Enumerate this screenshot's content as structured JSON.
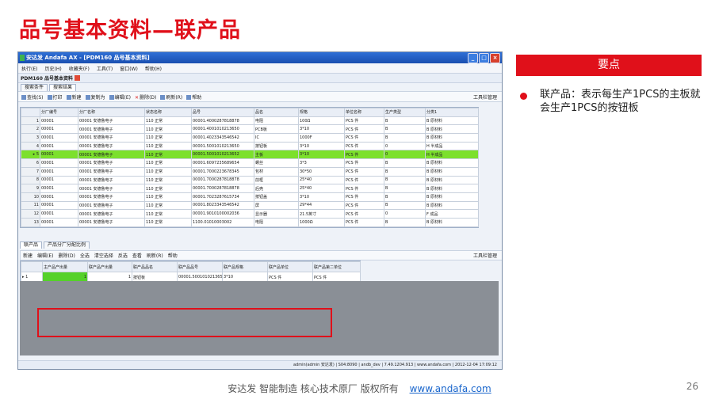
{
  "slide": {
    "title": "品号基本资料—联产品",
    "key_header": "要点",
    "bullet_text": "联产品：表示每生产1PCS的主板就会生产1PCS的按钮板",
    "footer_text": "安达发  智能制造 核心技术原厂  版权所有",
    "footer_link": "www.andafa.com",
    "page_number": "26"
  },
  "window": {
    "title": "安达发 Andafa AX - [PDM160 品号基本资料]",
    "buttons": [
      "_",
      "□",
      "×"
    ],
    "menu": [
      "执行(E)",
      "历史(H)",
      "收藏夹(F)",
      "工具(T)",
      "窗口(W)",
      "帮助(H)"
    ],
    "doc_title": "PDM160 品号基本资料",
    "tabs": [
      "搜索条件",
      "搜索结果"
    ],
    "toolbar": [
      "查找(S)",
      "打印",
      "新建",
      "复制为",
      "编辑(E)",
      "删除(D)",
      "刷新(R)",
      "帮助"
    ],
    "toolbar_right": "工具栏管理",
    "grid_headers": [
      "",
      "分厂编号",
      "分厂名称",
      "状态名称",
      "品号",
      "品名",
      "规格",
      "单位名称",
      "生产类型",
      "分类1"
    ],
    "grid_rows": [
      [
        "1",
        "00001",
        "00001 安德鲁电子",
        "110 正常",
        "00001.4000287818878",
        "电阻",
        "100Ω",
        "PCS 件",
        "B",
        "B 原材料"
      ],
      [
        "2",
        "00001",
        "00001 安德鲁电子",
        "110 正常",
        "00001.4001010213650",
        "PCB板",
        "3*10",
        "PCS 件",
        "B",
        "B 原材料"
      ],
      [
        "3",
        "00001",
        "00001 安德鲁电子",
        "110 正常",
        "00001.4023343546542",
        "IC",
        "1000F",
        "PCS 件",
        "B",
        "B 原材料"
      ],
      [
        "4",
        "00001",
        "00001 安德鲁电子",
        "110 正常",
        "00001.5001010213650",
        "按钮板",
        "3*10",
        "PCS 件",
        "0",
        "H 半成品"
      ],
      [
        "5",
        "00001",
        "00001 安德鲁电子",
        "110 正常",
        "00001.5001010213652",
        "主板",
        "3*10",
        "PCS 件",
        "0",
        "H 半成品"
      ],
      [
        "6",
        "00001",
        "00001 安德鲁电子",
        "110 正常",
        "00001.6097235689654",
        "螺丝",
        "3*3",
        "PCS 件",
        "B",
        "B 原材料"
      ],
      [
        "7",
        "00001",
        "00001 安德鲁电子",
        "110 正常",
        "00001.7000223678345",
        "包材",
        "30*50",
        "PCS 件",
        "B",
        "B 原材料"
      ],
      [
        "8",
        "00001",
        "00001 安德鲁电子",
        "110 正常",
        "00001.7000287818878",
        "前框",
        "25*40",
        "PCS 件",
        "B",
        "B 原材料"
      ],
      [
        "9",
        "00001",
        "00001 安德鲁电子",
        "110 正常",
        "00001.7000287818878",
        "后壳",
        "25*40",
        "PCS 件",
        "B",
        "B 原材料"
      ],
      [
        "10",
        "00001",
        "00001 安德鲁电子",
        "110 正常",
        "00001.7023287615734",
        "按钮盖",
        "3*10",
        "PCS 件",
        "B",
        "B 原材料"
      ],
      [
        "11",
        "00001",
        "00001 安德鲁电子",
        "110 正常",
        "00001.8023343546542",
        "屏",
        "29*44",
        "PCS 件",
        "B",
        "B 原材料"
      ],
      [
        "12",
        "00001",
        "00001 安德鲁电子",
        "110 正常",
        "00001.9010100002036",
        "显示器",
        "21.5英寸",
        "PCS 件",
        "0",
        "F 成品"
      ],
      [
        "13",
        "00001",
        "00001 安德鲁电子",
        "110 正常",
        "1100.01010003002",
        "电阻",
        "1000Ω",
        "PCS 件",
        "B",
        "B 原材料"
      ]
    ],
    "selected_row_index": 4,
    "bottom_tabs": [
      "联产品",
      "产品分厂分配比例"
    ],
    "bottom_toolbar": [
      "新建",
      "编辑(E)",
      "删除(D)",
      "全选",
      "清空选择",
      "反选",
      "查看",
      "刷新(R)",
      "帮助"
    ],
    "bottom_toolbar_right": "工具栏管理",
    "sub_headers": [
      "",
      "主产品产出量",
      "联产品产出量",
      "联产品品名",
      "联产品品号",
      "联产品规格",
      "联产品单位",
      "联产品第二单位"
    ],
    "sub_rows": [
      [
        "1",
        "1",
        "1",
        "按钮板",
        "00001.5001010213650",
        "3*10",
        "PCS 件",
        "PCS 件"
      ]
    ],
    "status_text": "admin(admin 安达发) | S04:8090 | andb_dev | 7.49.1204.913 | www.andafa.com | 2012-12-04 17:09:12"
  }
}
